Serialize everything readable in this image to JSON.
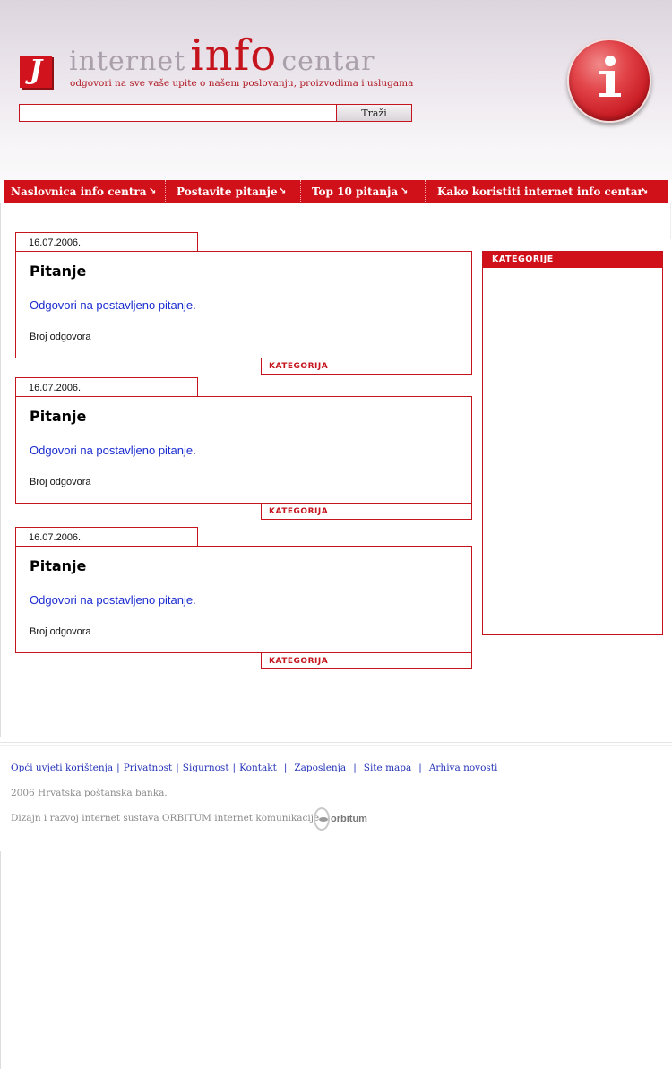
{
  "header": {
    "brand": {
      "word1": "internet",
      "word2": "info",
      "word3": "centar"
    },
    "tagline": "odgovori na sve vaše upite o našem poslovanju, proizvodima i uslugama",
    "logo_glyph": "J",
    "search": {
      "value": "",
      "button_label": "Traži"
    },
    "badge_glyph": "i"
  },
  "nav": {
    "items": [
      {
        "label": "Naslovnica info centra",
        "arrow": "↘"
      },
      {
        "label": "Postavite pitanje",
        "arrow": "↘"
      },
      {
        "label": "Top 10 pitanja",
        "arrow": "↘"
      },
      {
        "label": "Kako koristiti internet info centar",
        "arrow": "↘"
      }
    ]
  },
  "questions": [
    {
      "date": "16.07.2006.",
      "title": "Pitanje",
      "link": "Odgovori na postavljeno pitanje.",
      "count_label": "Broj odgovora",
      "category": "KATEGORIJA"
    },
    {
      "date": "16.07.2006.",
      "title": "Pitanje",
      "link": "Odgovori na postavljeno pitanje.",
      "count_label": "Broj odgovora",
      "category": "KATEGORIJA"
    },
    {
      "date": "16.07.2006.",
      "title": "Pitanje",
      "link": "Odgovori na postavljeno pitanje.",
      "count_label": "Broj odgovora",
      "category": "KATEGORIJA"
    }
  ],
  "sidebar": {
    "heading": "KATEGORIJE"
  },
  "footer": {
    "links": [
      "Opći uvjeti korištenja",
      "Privatnost",
      "Sigurnost",
      "Kontakt",
      "Zaposlenja",
      "Site mapa",
      "Arhiva novosti"
    ],
    "separator": "|",
    "copyright": "2006  Hrvatska poštanska banka.",
    "credits": "Dizajn i razvoj internet sustava ORBITUM internet komunikacije",
    "partner_logo_text": "orbitum"
  },
  "colors": {
    "brand_red": "#d0111a",
    "link_blue": "#1a2bd0",
    "muted_grey": "#aaa0ab"
  }
}
